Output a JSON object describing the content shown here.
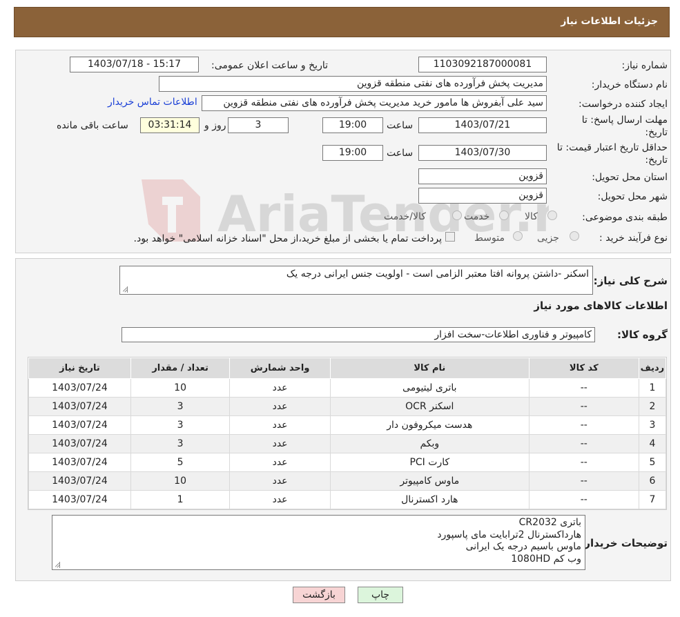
{
  "page_title": "جزئیات اطلاعات نیاز",
  "fields": {
    "need_number_label": "شماره نیاز:",
    "need_number": "1103092187000081",
    "announce_label": "تاریخ و ساعت اعلان عمومی:",
    "announce_value": "1403/07/18 - 15:17",
    "buyer_org_label": "نام دستگاه خریدار:",
    "buyer_org": "مدیریت پخش فرآورده های نفتی منطقه قزوین",
    "creator_label": "ایجاد کننده درخواست:",
    "creator": "سید علی  آبفروش ها مامور خرید مدیریت پخش فرآورده های نفتی منطقه قزوین",
    "contact_link": "اطلاعات تماس خریدار",
    "deadline_label_1": "مهلت ارسال پاسخ: تا",
    "deadline_label_2": "تاریخ:",
    "deadline_date": "1403/07/21",
    "time_label": "ساعت",
    "deadline_time": "19:00",
    "days_value": "3",
    "days_label": "روز و",
    "remaining_time": "03:31:14",
    "remaining_label": "ساعت باقی مانده",
    "validity_label_1": "حداقل تاریخ اعتبار قیمت: تا",
    "validity_label_2": "تاریخ:",
    "validity_date": "1403/07/30",
    "validity_time": "19:00",
    "province_label": "استان محل تحویل:",
    "province": "قزوین",
    "city_label": "شهر محل تحویل:",
    "city": "قزوین",
    "category_label": "طبقه بندی موضوعی:",
    "category_options": [
      "کالا",
      "خدمت",
      "کالا/خدمت"
    ],
    "process_label": "نوع فرآیند خرید :",
    "process_options": [
      "جزیی",
      "متوسط"
    ],
    "process_note": "پرداخت تمام یا بخشی از مبلغ خرید،از محل \"اسناد خزانه اسلامی\" خواهد بود."
  },
  "description_label": "شرح کلی نیاز:",
  "description": "اسکنر -داشتن پروانه افتا معتبر الزامی است - اولویت جنس ایرانی درجه یک",
  "goods_title": "اطلاعات کالاهای مورد نیاز",
  "goods_group_label": "گروه کالا:",
  "goods_group": "کامپیوتر و فناوری اطلاعات-سخت افزار",
  "table": {
    "headers": [
      "ردیف",
      "کد کالا",
      "نام کالا",
      "واحد شمارش",
      "تعداد / مقدار",
      "تاریخ نیاز"
    ],
    "rows": [
      [
        "1",
        "--",
        "باتری لیتیومی",
        "عدد",
        "10",
        "1403/07/24"
      ],
      [
        "2",
        "--",
        "اسکنر OCR",
        "عدد",
        "3",
        "1403/07/24"
      ],
      [
        "3",
        "--",
        "هدست میکروفون دار",
        "عدد",
        "3",
        "1403/07/24"
      ],
      [
        "4",
        "--",
        "وبکم",
        "عدد",
        "3",
        "1403/07/24"
      ],
      [
        "5",
        "--",
        "کارت PCI",
        "عدد",
        "5",
        "1403/07/24"
      ],
      [
        "6",
        "--",
        "ماوس کامپیوتر",
        "عدد",
        "10",
        "1403/07/24"
      ],
      [
        "7",
        "--",
        "هارد اکسترنال",
        "عدد",
        "1",
        "1403/07/24"
      ]
    ]
  },
  "buyer_notes_label": "توضیحات خریدار:",
  "buyer_notes": [
    "باتری CR2032",
    "هارداکسترنال 2ترابایت مای پاسپورد",
    "ماوس باسیم درجه یک ایرانی",
    "وب کم 1080HD"
  ],
  "buttons": {
    "print": "چاپ",
    "back": "بازگشت"
  },
  "colors": {
    "header_bg": "#8b6239",
    "link": "#1a3fd6",
    "back_btn": "#f7d4d4",
    "print_btn": "#dcf5dc"
  },
  "watermark_text": "AriaTender.neT"
}
